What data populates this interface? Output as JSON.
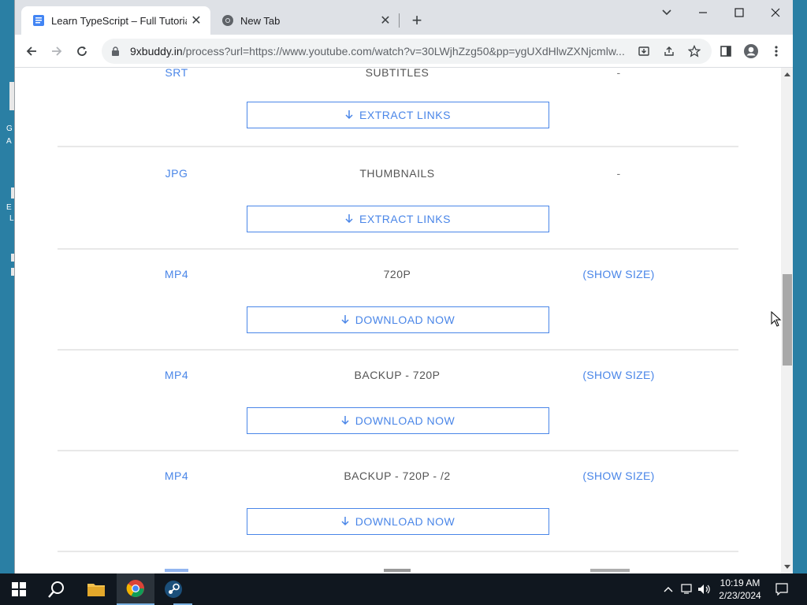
{
  "tabs": [
    {
      "title": "Learn TypeScript – Full Tutorial",
      "active": true
    },
    {
      "title": "New Tab",
      "active": false
    }
  ],
  "address_bar": {
    "host": "9xbuddy.in",
    "path": "/process?url=https://www.youtube.com/watch?v=30LWjhZzg50&pp=ygUXdHlwZXNjcmlw..."
  },
  "desktop_icons": [
    "G",
    "A",
    "E",
    "L"
  ],
  "rows": [
    {
      "format": "SRT",
      "quality": "SUBTITLES",
      "size": "-",
      "button": "EXTRACT LINKS"
    },
    {
      "format": "JPG",
      "quality": "THUMBNAILS",
      "size": "-",
      "button": "EXTRACT LINKS"
    },
    {
      "format": "MP4",
      "quality": "720P",
      "size": "(SHOW SIZE)",
      "button": "DOWNLOAD NOW"
    },
    {
      "format": "MP4",
      "quality": "BACKUP - 720P",
      "size": "(SHOW SIZE)",
      "button": "DOWNLOAD NOW"
    },
    {
      "format": "MP4",
      "quality": "BACKUP - 720P - /2",
      "size": "(SHOW SIZE)",
      "button": "DOWNLOAD NOW"
    }
  ],
  "clock": {
    "time": "10:19 AM",
    "date": "2/23/2024"
  },
  "colors": {
    "link_blue": "#4a86e8",
    "taskbar": "#10171f",
    "tab_bar": "#dee1e6"
  }
}
